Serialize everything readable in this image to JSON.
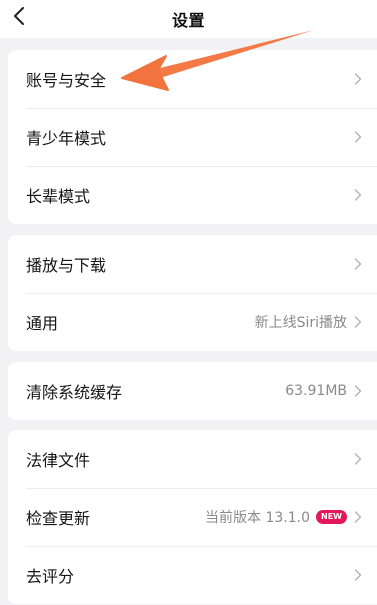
{
  "header": {
    "title": "设置"
  },
  "colors": {
    "arrow": "#f2733d",
    "badge": "#e2185b"
  },
  "sections": [
    {
      "items": [
        {
          "label": "账号与安全",
          "value": ""
        },
        {
          "label": "青少年模式",
          "value": ""
        },
        {
          "label": "长辈模式",
          "value": ""
        }
      ]
    },
    {
      "items": [
        {
          "label": "播放与下载",
          "value": ""
        },
        {
          "label": "通用",
          "value": "新上线Siri播放"
        }
      ]
    },
    {
      "items": [
        {
          "label": "清除系统缓存",
          "value": "63.91MB"
        }
      ]
    },
    {
      "items": [
        {
          "label": "法律文件",
          "value": ""
        },
        {
          "label": "检查更新",
          "value": "当前版本 13.1.0",
          "badge": "NEW"
        },
        {
          "label": "去评分",
          "value": ""
        }
      ]
    }
  ]
}
